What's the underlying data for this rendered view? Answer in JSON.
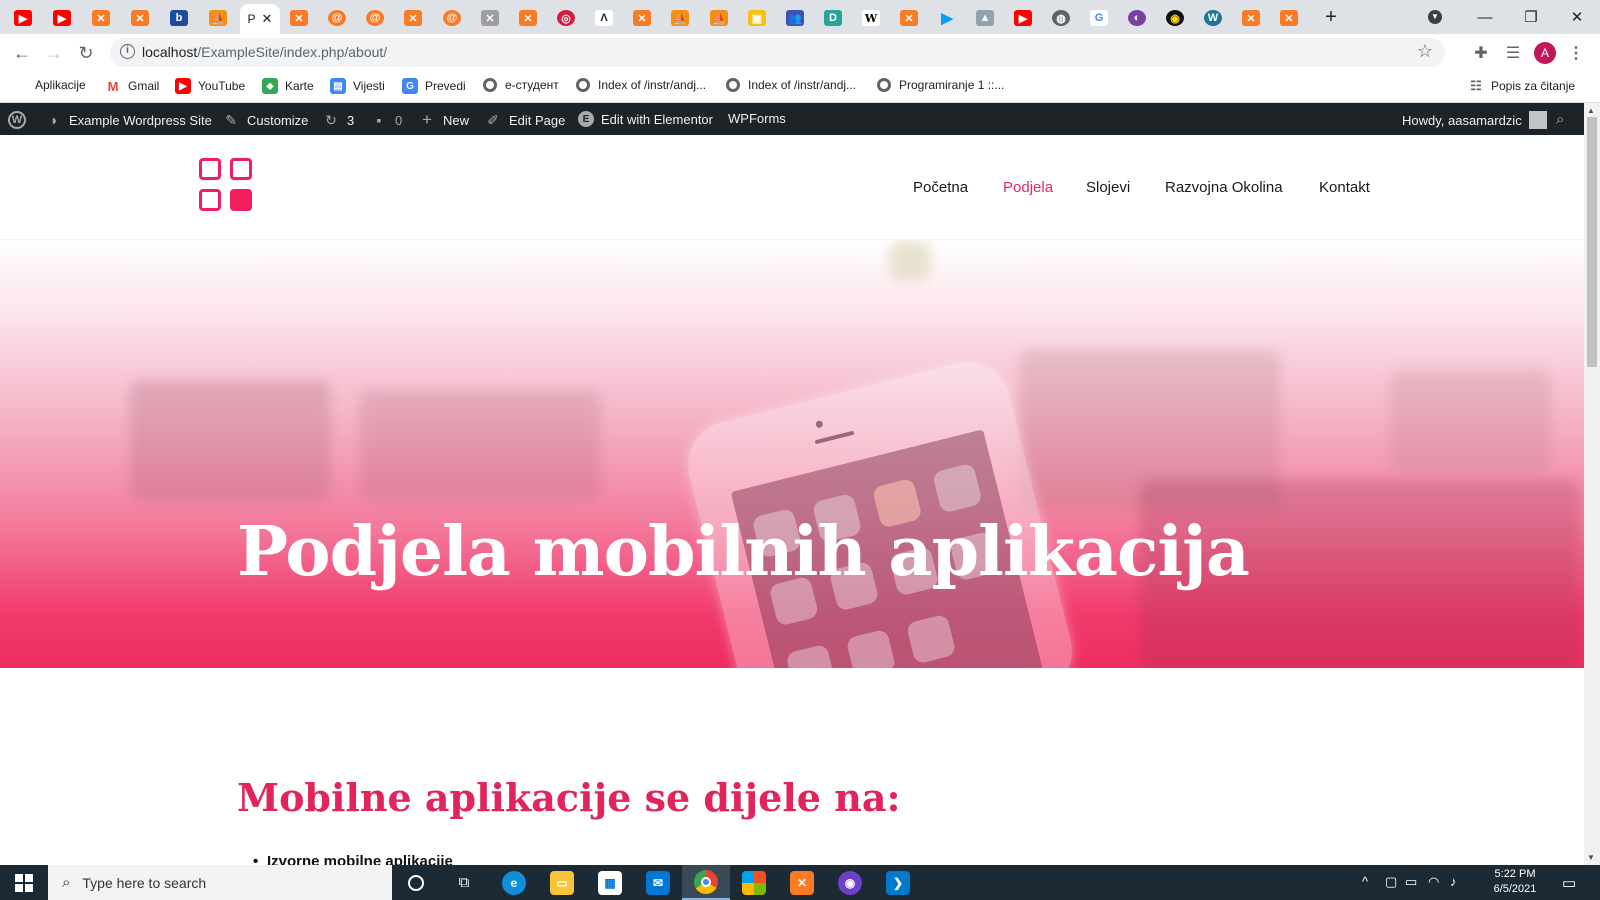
{
  "browser": {
    "url_host": "localhost",
    "url_path": "/ExampleSite/index.php/about/",
    "active_tab_title": "P",
    "profile_initial": "A",
    "accent": "#1a73e8"
  },
  "bookmarks": [
    {
      "label": "Aplikacije",
      "icon": "apps-grid-icon"
    },
    {
      "label": "Gmail",
      "icon": "gmail-icon"
    },
    {
      "label": "YouTube",
      "icon": "youtube-icon"
    },
    {
      "label": "Karte",
      "icon": "maps-icon"
    },
    {
      "label": "Vijesti",
      "icon": "news-icon"
    },
    {
      "label": "Prevedi",
      "icon": "translate-icon"
    },
    {
      "label": "e-студент",
      "icon": "globe-icon"
    },
    {
      "label": "Index of /instr/andj...",
      "icon": "globe-icon"
    },
    {
      "label": "Index of /instr/andj...",
      "icon": "globe-icon"
    },
    {
      "label": "Programiranje 1 ::...",
      "icon": "globe-icon"
    }
  ],
  "reading_list": "Popis za čitanje",
  "adminbar": {
    "site": "Example Wordpress Site",
    "customize": "Customize",
    "updates": "3",
    "comments": "0",
    "new": "New",
    "edit_page": "Edit Page",
    "elementor": "Edit with Elementor",
    "wpforms": "WPForms",
    "howdy": "Howdy, aasamardzic"
  },
  "nav": {
    "items": [
      "Početna",
      "Podjela",
      "Slojevi",
      "Razvojna Okolina",
      "Kontakt"
    ],
    "current": "Podjela"
  },
  "hero": {
    "title": "Podjela mobilnih aplikacija"
  },
  "content": {
    "heading": "Mobilne aplikacije se dijele na:",
    "first_item": "Izvorne mobilne aplikacije"
  },
  "taskbar": {
    "search_placeholder": "Type here to search",
    "time": "5:22 PM",
    "date": "6/5/2021"
  },
  "colors": {
    "brand_pink": "#f21f5f",
    "heading_pink": "#e1245a",
    "adminbar_bg": "#1d2327",
    "taskbar_bg": "#1c2a36"
  }
}
